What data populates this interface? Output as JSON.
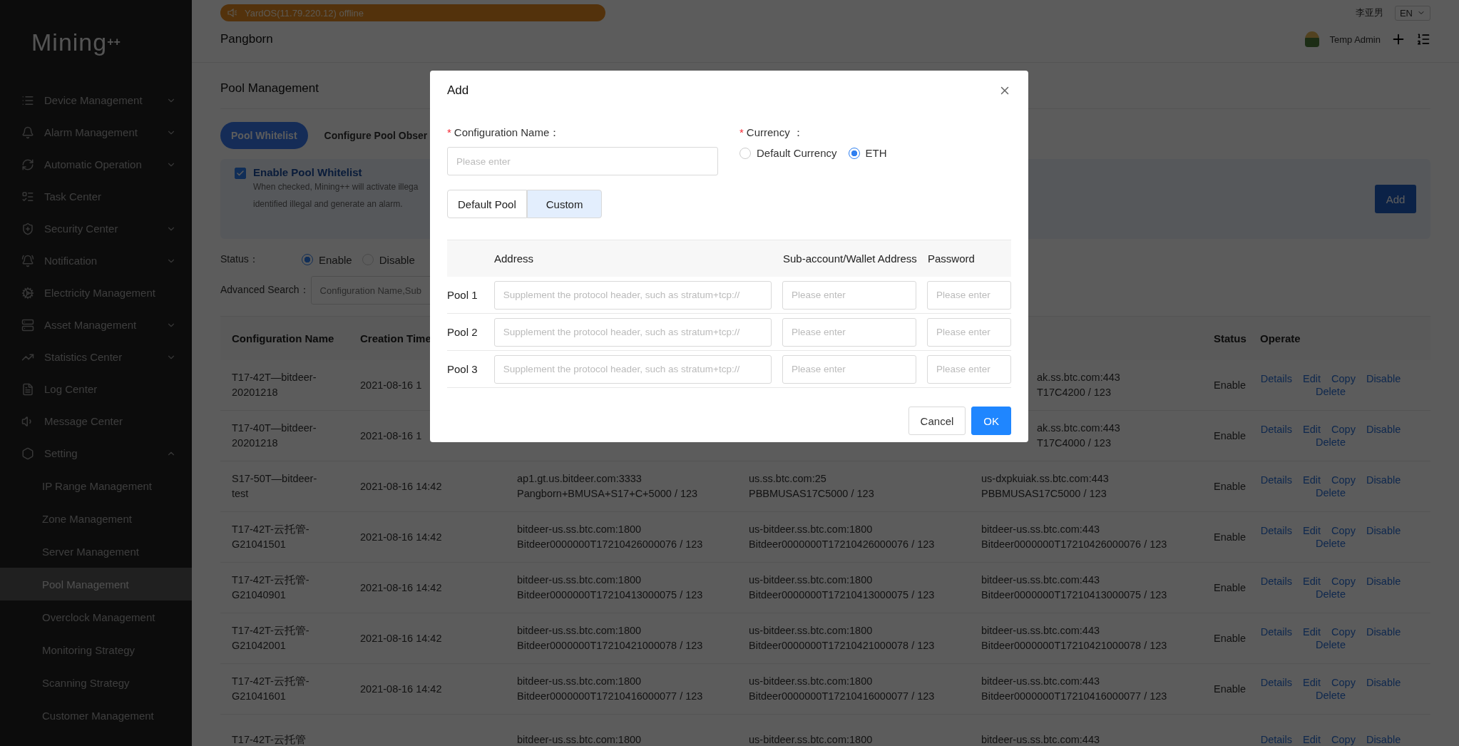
{
  "sidebar": {
    "logo": {
      "text": "Mining",
      "suffix": "++"
    },
    "items": [
      {
        "label": "Device Management",
        "expanded": false,
        "selected": false
      },
      {
        "label": "Alarm Management",
        "expanded": false,
        "selected": false
      },
      {
        "label": "Automatic Operation",
        "expanded": false,
        "selected": false
      },
      {
        "label": "Task Center",
        "selected": false
      },
      {
        "label": "Security Center",
        "expanded": false,
        "selected": false
      },
      {
        "label": "Notification",
        "expanded": false,
        "selected": false
      },
      {
        "label": "Electricity Management",
        "selected": false
      },
      {
        "label": "Asset Management",
        "expanded": false,
        "selected": false
      },
      {
        "label": "Statistics Center",
        "expanded": false,
        "selected": false
      },
      {
        "label": "Log Center",
        "selected": false
      },
      {
        "label": "Message Center",
        "selected": false
      },
      {
        "label": "Setting",
        "expanded": true,
        "selected": false,
        "children": [
          {
            "label": "IP Range Management",
            "selected": false
          },
          {
            "label": "Zone Management",
            "selected": false
          },
          {
            "label": "Server Management",
            "selected": false
          },
          {
            "label": "Pool Management",
            "selected": true
          },
          {
            "label": "Overclock Management",
            "selected": false
          },
          {
            "label": "Monitoring Strategy",
            "selected": false
          },
          {
            "label": "Scanning Strategy",
            "selected": false
          },
          {
            "label": "Customer Management",
            "selected": false
          }
        ]
      }
    ]
  },
  "topbar": {
    "notice": "YardOS(11.79.220.12) offline",
    "user_name": "李亚男",
    "language": "EN",
    "site": "Pangborn",
    "role": "Temp Admin"
  },
  "page": {
    "title": "Pool Management",
    "tabs": [
      {
        "label": "Pool Whitelist",
        "selected": true
      },
      {
        "label": "Configure Pool Obser",
        "selected": false
      }
    ],
    "whitelist": {
      "label": "Enable Pool Whitelist",
      "checked": true,
      "description_1": "When checked, Mining++ will activate illega",
      "description_2": "identified illegal and generate an alarm.",
      "add_button": "Add"
    },
    "status_filter": {
      "label": "Status：",
      "options": [
        {
          "label": "Enable",
          "selected": true
        },
        {
          "label": "Disable",
          "selected": false
        }
      ]
    },
    "advanced_search": {
      "label": "Advanced Search：",
      "placeholder": "Configuration Name,Sub"
    },
    "table": {
      "columns": [
        "Configuration Name",
        "Creation Time",
        "Status",
        "Operate"
      ],
      "rows": [
        {
          "kind": "covered",
          "name": "T17-42T—bitdeer-20201218",
          "time": "2021-08-16 1",
          "col5": "ak.ss.btc.com:443\nT17C4200 / 123",
          "status": "Enable",
          "actions": [
            "Details",
            "Edit",
            "Copy",
            "Disable",
            "Delete"
          ]
        },
        {
          "kind": "covered",
          "name": "T17-40T—bitdeer-20201218",
          "time": "2021-08-16 1",
          "col5": "ak.ss.btc.com:443\nT17C4000 / 123",
          "status": "Enable",
          "actions": [
            "Details",
            "Edit",
            "Copy",
            "Disable",
            "Delete"
          ]
        },
        {
          "kind": "full",
          "name": "S17-50T—bitdeer-test",
          "time": "2021-08-16 14:42",
          "col3": "ap1.gt.us.bitdeer.com:3333\nPangborn+BMUSA+S17+C+5000 / 123",
          "col4": "us.ss.btc.com:25\nPBBMUSAS17C5000 / 123",
          "col5": "us-dxpkuiak.ss.btc.com:443\nPBBMUSAS17C5000 / 123",
          "status": "Enable",
          "actions": [
            "Details",
            "Edit",
            "Copy",
            "Disable",
            "Delete"
          ]
        },
        {
          "kind": "full",
          "name": "T17-42T-云托管-G21041501",
          "time": "2021-08-16 14:42",
          "col3": "bitdeer-us.ss.btc.com:1800\nBitdeer0000000T17210426000076 / 123",
          "col4": "us-bitdeer.ss.btc.com:1800\nBitdeer0000000T17210426000076 / 123",
          "col5": "bitdeer-us.ss.btc.com:443\nBitdeer0000000T17210426000076 / 123",
          "status": "Enable",
          "actions": [
            "Details",
            "Edit",
            "Copy",
            "Disable",
            "Delete"
          ]
        },
        {
          "kind": "full",
          "name": "T17-42T-云托管-G21040901",
          "time": "2021-08-16 14:42",
          "col3": "bitdeer-us.ss.btc.com:1800\nBitdeer0000000T17210413000075 / 123",
          "col4": "us-bitdeer.ss.btc.com:1800\nBitdeer0000000T17210413000075 / 123",
          "col5": "bitdeer-us.ss.btc.com:443\nBitdeer0000000T17210413000075 / 123",
          "status": "Enable",
          "actions": [
            "Details",
            "Edit",
            "Copy",
            "Disable",
            "Delete"
          ]
        },
        {
          "kind": "full",
          "name": "T17-42T-云托管-G21042001",
          "time": "2021-08-16 14:42",
          "col3": "bitdeer-us.ss.btc.com:1800\nBitdeer0000000T17210421000078 / 123",
          "col4": "us-bitdeer.ss.btc.com:1800\nBitdeer0000000T17210421000078 / 123",
          "col5": "bitdeer-us.ss.btc.com:443\nBitdeer0000000T17210421000078 / 123",
          "status": "Enable",
          "actions": [
            "Details",
            "Edit",
            "Copy",
            "Disable",
            "Delete"
          ]
        },
        {
          "kind": "full",
          "name": "T17-42T-云托管-G21041601",
          "time": "2021-08-16 14:42",
          "col3": "bitdeer-us.ss.btc.com:1800\nBitdeer0000000T17210416000077 / 123",
          "col4": "us-bitdeer.ss.btc.com:1800\nBitdeer0000000T17210416000077 / 123",
          "col5": "bitdeer-us.ss.btc.com:443\nBitdeer0000000T17210416000077 / 123",
          "status": "Enable",
          "actions": [
            "Details",
            "Edit",
            "Copy",
            "Disable",
            "Delete"
          ]
        },
        {
          "kind": "full",
          "name": "T17-42T-云托管",
          "col3": "bitdeer-us.ss.btc.com:1800",
          "col4": "us-bitdeer.ss.btc.com:1800",
          "col5": "bitdeer-us.ss.btc.com:443",
          "actions": [
            "Details",
            "Edit",
            "Copy",
            "Disable"
          ]
        }
      ]
    }
  },
  "dialog": {
    "title": "Add",
    "config_name": {
      "required_mark": "*",
      "label": "Configuration Name：",
      "placeholder": "Please enter"
    },
    "currency": {
      "required_mark": "*",
      "label": "Currency ：",
      "options": [
        {
          "label": "Default Currency",
          "selected": false
        },
        {
          "label": "ETH",
          "selected": true
        }
      ]
    },
    "pool_mode": [
      {
        "label": "Default Pool",
        "selected": false
      },
      {
        "label": "Custom",
        "selected": true
      }
    ],
    "columns": [
      "Address",
      "Sub-account/Wallet Address",
      "Password"
    ],
    "pools": [
      {
        "label": "Pool 1",
        "address_placeholder": "Supplement the protocol header, such as stratum+tcp://",
        "account_placeholder": "Please enter",
        "password_placeholder": "Please enter"
      },
      {
        "label": "Pool 2",
        "address_placeholder": "Supplement the protocol header, such as stratum+tcp://",
        "account_placeholder": "Please enter",
        "password_placeholder": "Please enter"
      },
      {
        "label": "Pool 3",
        "address_placeholder": "Supplement the protocol header, such as stratum+tcp://",
        "account_placeholder": "Please enter",
        "password_placeholder": "Please enter"
      }
    ],
    "cancel": "Cancel",
    "ok": "OK"
  }
}
